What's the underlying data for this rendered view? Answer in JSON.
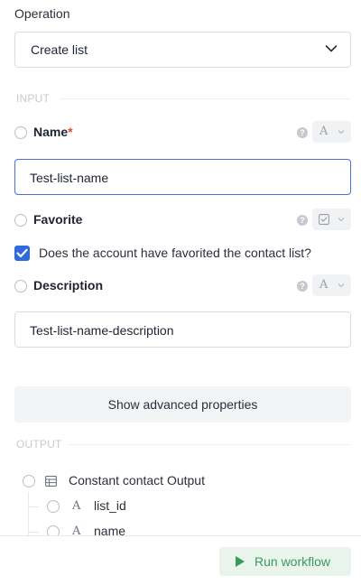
{
  "operation": {
    "label": "Operation",
    "selected": "Create list"
  },
  "input_section": {
    "title": "INPUT"
  },
  "fields": {
    "name": {
      "label": "Name",
      "required_mark": "*",
      "type_glyph": "A",
      "value": "Test-list-name"
    },
    "favorite": {
      "label": "Favorite",
      "checkbox_label": "Does the account have favorited the contact list?",
      "checked": true
    },
    "description": {
      "label": "Description",
      "type_glyph": "A",
      "value": "Test-list-name-description"
    }
  },
  "advanced_button": {
    "label": "Show advanced properties"
  },
  "output_section": {
    "title": "OUTPUT"
  },
  "output_tree": {
    "root": {
      "label": "Constant contact Output"
    },
    "children": [
      {
        "type_glyph": "A",
        "label": "list_id"
      },
      {
        "type_glyph": "A",
        "label": "name"
      }
    ]
  },
  "footer": {
    "run_label": "Run workflow"
  },
  "colors": {
    "accent": "#2f6bdb",
    "focus_border": "#4a6fd8",
    "required": "#e0472f",
    "run_green": "#3a9a5b",
    "run_bg": "#e9f5ec"
  }
}
